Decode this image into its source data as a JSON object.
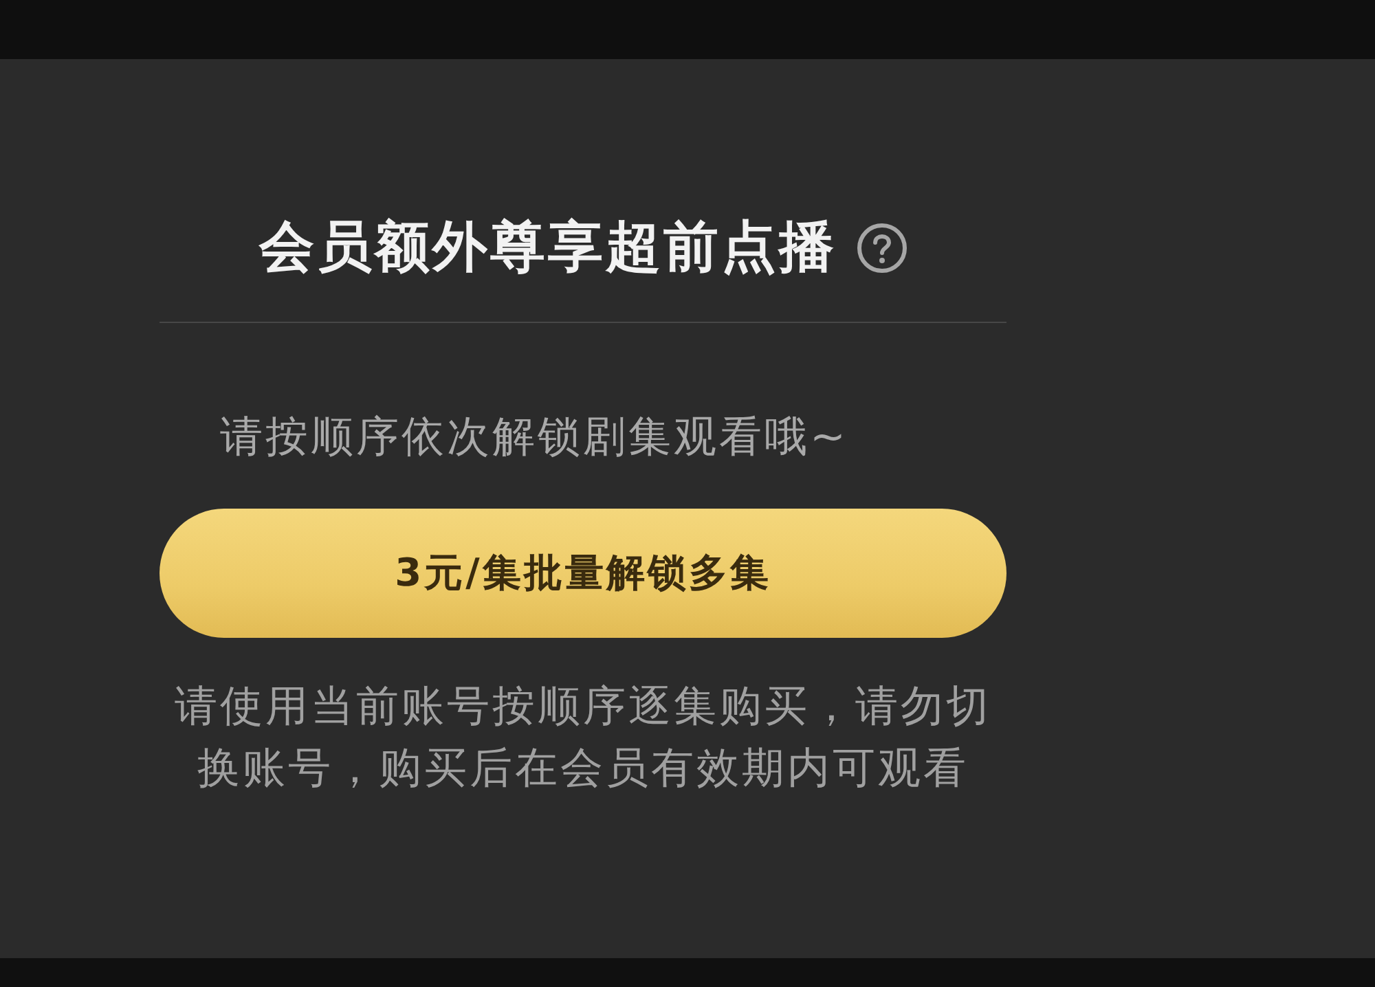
{
  "dialog": {
    "title": "会员额外尊享超前点播",
    "subtitle": "请按顺序依次解锁剧集观看哦~",
    "unlock_button": {
      "label": "3元/集批量解锁多集"
    },
    "note": "请使用当前账号按顺序逐集购买，请勿切换账号，购买后在会员有效期内可观看"
  }
}
